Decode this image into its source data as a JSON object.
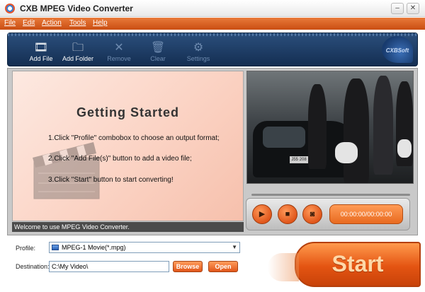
{
  "window": {
    "title": "CXB MPEG Video Converter",
    "minimize": "–",
    "close": "✕"
  },
  "menu": [
    "File",
    "Edit",
    "Action",
    "Tools",
    "Help"
  ],
  "toolbar": {
    "add_file": "Add File",
    "add_folder": "Add  Folder",
    "remove": "Remove",
    "clear": "Clear",
    "settings": "Settings",
    "brand": "CXBSoft"
  },
  "getting_started": {
    "title": "Getting  Started",
    "step1": "1.Click \"Profile\" combobox to choose an output format;",
    "step2": "2.Click \"Add File(s)\" button to add a video file;",
    "step3": "3.Click \"Start\" button to start converting!"
  },
  "status": "Welcome to use MPEG Video Converter.",
  "player": {
    "plate": "J55 208",
    "time": "00:00:00/00:00:00"
  },
  "profile": {
    "label": "Profile:",
    "value": "MPEG-1 Movie(*.mpg)"
  },
  "destination": {
    "label": "Destination:",
    "value": "C:\\My Video\\",
    "browse": "Browse",
    "open": "Open"
  },
  "start": "Start",
  "colors": {
    "accent": "#e45412",
    "toolbar": "#1f3f6b"
  }
}
